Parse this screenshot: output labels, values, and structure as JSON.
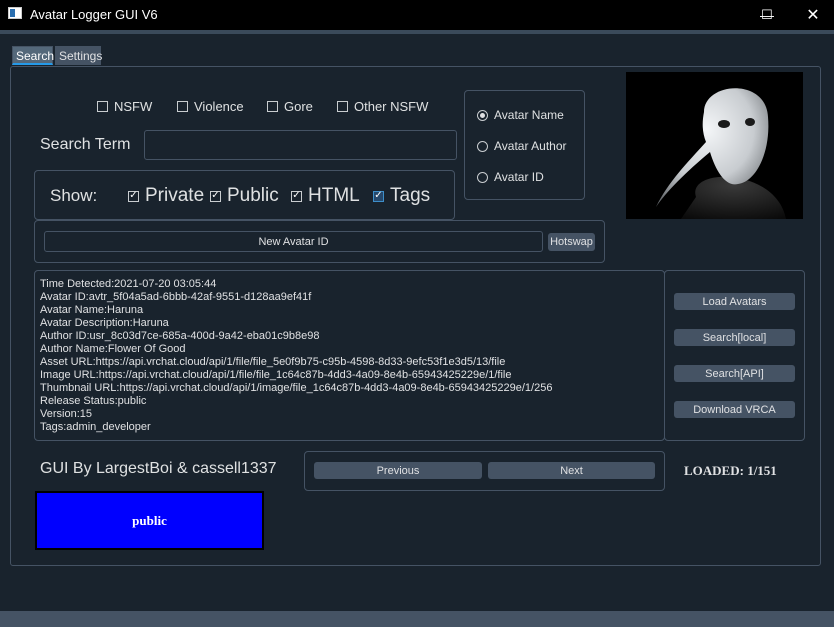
{
  "window": {
    "title": "Avatar Logger GUI V6",
    "minimize": "—",
    "maximize": "☐",
    "close": "✕"
  },
  "tabs": [
    {
      "label": "Search"
    },
    {
      "label": "Settings"
    }
  ],
  "filters": [
    {
      "label": "NSFW",
      "checked": false
    },
    {
      "label": "Violence",
      "checked": false
    },
    {
      "label": "Gore",
      "checked": false
    },
    {
      "label": "Other NSFW",
      "checked": false
    }
  ],
  "search": {
    "label": "Search Term",
    "value": "",
    "placeholder": ""
  },
  "show": {
    "label": "Show:",
    "options": [
      {
        "label": "Private",
        "checked": true
      },
      {
        "label": "Public",
        "checked": true
      },
      {
        "label": "HTML",
        "checked": true
      },
      {
        "label": "Tags",
        "checked": true
      }
    ]
  },
  "search_by": [
    {
      "label": "Avatar Name",
      "selected": true
    },
    {
      "label": "Avatar Author",
      "selected": false
    },
    {
      "label": "Avatar ID",
      "selected": false
    }
  ],
  "new_avatar_id": {
    "button_label": "New Avatar ID",
    "hotswap_label": "Hotswap"
  },
  "avatar_info": [
    "Time Detected:2021-07-20 03:05:44",
    "Avatar ID:avtr_5f04a5ad-6bbb-42af-9551-d128aa9ef41f",
    "Avatar Name:Haruna",
    "Avatar Description:Haruna",
    "Author ID:usr_8c03d7ce-685a-400d-9a42-eba01c9b8e98",
    "Author Name:Flower Of Good",
    "Asset URL:https://api.vrchat.cloud/api/1/file/file_5e0f9b75-c95b-4598-8d33-9efc53f1e3d5/13/file",
    "Image URL:https://api.vrchat.cloud/api/1/file/file_1c64c87b-4dd3-4a09-8e4b-65943425229e/1/file",
    "Thumbnail URL:https://api.vrchat.cloud/api/1/image/file_1c64c87b-4dd3-4a09-8e4b-65943425229e/1/256",
    "Release Status:public",
    "Version:15",
    "Tags:admin_developer"
  ],
  "actions": {
    "load": "Load Avatars",
    "search_local": "Search[local]",
    "search_api": "Search[API]",
    "download": "Download VRCA"
  },
  "credits": "GUI By LargestBoi & cassell1337",
  "nav": {
    "previous": "Previous",
    "next": "Next",
    "loaded": "LOADED: 1/151"
  },
  "status": {
    "label": "public",
    "color": "#0000ff"
  },
  "thumbnail": {
    "icon": "plague-mask-avatar-image"
  },
  "colors": {
    "background": "#19232d",
    "border": "#455364",
    "accent": "#259ae9"
  }
}
